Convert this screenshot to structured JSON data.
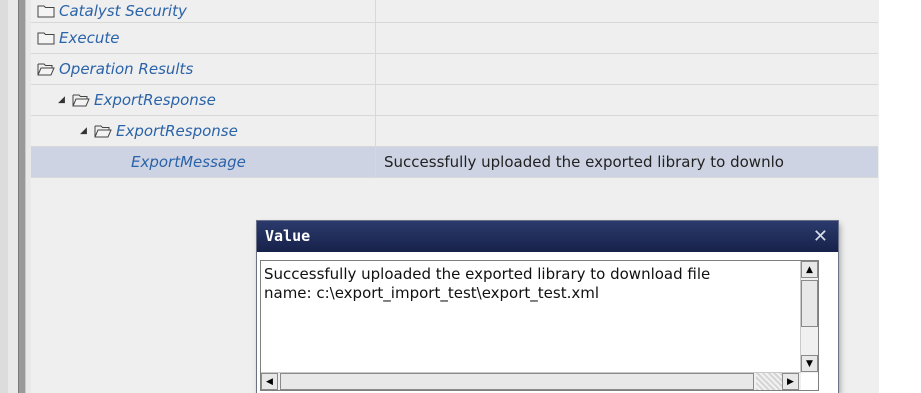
{
  "tree": {
    "rows": [
      {
        "label": "Catalyst Security",
        "icon": "folder-closed-icon",
        "value": ""
      },
      {
        "label": "Execute",
        "icon": "folder-closed-icon",
        "value": ""
      },
      {
        "label": "Operation Results",
        "icon": "folder-open-icon",
        "value": ""
      },
      {
        "label": "ExportResponse",
        "icon": "folder-open-icon",
        "value": ""
      },
      {
        "label": "ExportResponse",
        "icon": "folder-open-icon",
        "value": ""
      },
      {
        "label": "ExportMessage",
        "icon": "",
        "value": "Successfully uploaded the exported library to downlo"
      }
    ]
  },
  "dialog": {
    "title": "Value",
    "close_glyph": "✕",
    "content": "Successfully uploaded the exported library to download file\nname: c:\\export_import_test\\export_test.xml"
  },
  "colors": {
    "accent_text": "#2a63a8",
    "selected_row": "#cdd3e3",
    "title_bar": "#1e2a58"
  }
}
